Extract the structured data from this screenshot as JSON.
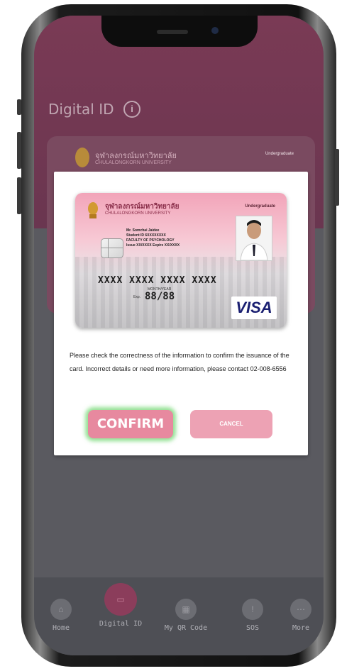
{
  "header": {
    "title": "Digital ID",
    "info_icon": "info-icon"
  },
  "background_card": {
    "university_th": "จุฬาลงกรณ์มหาวิทยาลัย",
    "university_en": "CHULALONGKORN UNIVERSITY",
    "role": "Undergraduate"
  },
  "dialog": {
    "card": {
      "university_th": "จุฬาลงกรณ์มหาวิทยาลัย",
      "university_en": "CHULALONGKORN UNIVERSITY",
      "role": "Undergraduate",
      "info_lines": [
        "Mr. Somchai Jaidee",
        "Student ID 6XXXXXXXX",
        "FACULTY OF PSYCHOLOGY",
        "Issue XX/XXXX Expire XX/XXXX"
      ],
      "number": "XXXX XXXX XXXX XXXX",
      "month_year_label": "MONTH/YEAR",
      "exp_label": "Exp.",
      "exp_value": "88/88",
      "brand": "VISA"
    },
    "message": "Please check the correctness of the information to confirm the issuance of the card. Incorrect details or need more information, please contact 02-008-6556",
    "confirm_label": "CONFIRM",
    "cancel_label": "CANCEL"
  },
  "bottom_nav": [
    {
      "label": "Home",
      "icon": "home-icon"
    },
    {
      "label": "Digital ID",
      "icon": "id-card-icon",
      "active": true
    },
    {
      "label": "My QR Code",
      "icon": "qr-code-icon"
    },
    {
      "label": "SOS",
      "icon": "sos-icon"
    },
    {
      "label": "More",
      "icon": "more-icon"
    }
  ],
  "colors": {
    "accent": "#e7899f",
    "header_band": "#7a3a55",
    "confirm_glow": "#3cc83c"
  }
}
